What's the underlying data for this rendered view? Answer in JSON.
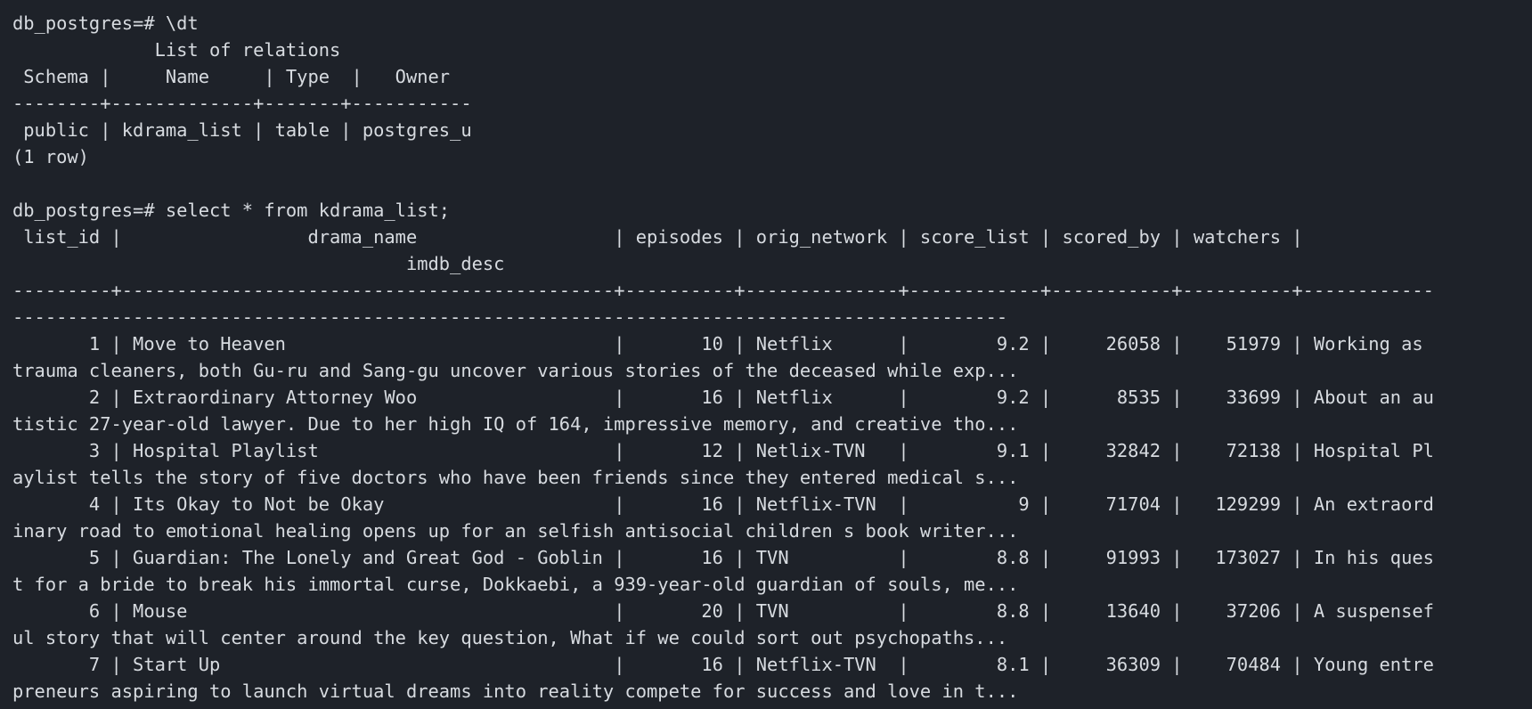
{
  "terminal": {
    "lines": [
      "db_postgres=# \\dt",
      "             List of relations",
      " Schema |     Name     | Type  |   Owner",
      "--------+-------------+-------+-----------",
      " public | kdrama_list | table | postgres_u",
      "(1 row)",
      "",
      "db_postgres=# select * from kdrama_list;",
      " list_id |                 drama_name                  | episodes | orig_network | score_list | scored_by | watchers |",
      "                                    imdb_desc",
      "---------+---------------------------------------------+----------+--------------+------------+-----------+----------+------------",
      "-------------------------------------------------------------------------------------------",
      "       1 | Move to Heaven                              |       10 | Netflix      |        9.2 |     26058 |    51979 | Working as",
      "trauma cleaners, both Gu-ru and Sang-gu uncover various stories of the deceased while exp...",
      "       2 | Extraordinary Attorney Woo                  |       16 | Netflix      |        9.2 |      8535 |    33699 | About an au",
      "tistic 27-year-old lawyer. Due to her high IQ of 164, impressive memory, and creative tho...",
      "       3 | Hospital Playlist                           |       12 | Netlix-TVN   |        9.1 |     32842 |    72138 | Hospital Pl",
      "aylist tells the story of five doctors who have been friends since they entered medical s...",
      "       4 | Its Okay to Not be Okay                     |       16 | Netflix-TVN  |          9 |     71704 |   129299 | An extraord",
      "inary road to emotional healing opens up for an selfish antisocial children s book writer...",
      "       5 | Guardian: The Lonely and Great God - Goblin |       16 | TVN          |        8.8 |     91993 |   173027 | In his ques",
      "t for a bride to break his immortal curse, Dokkaebi, a 939-year-old guardian of souls, me...",
      "       6 | Mouse                                       |       20 | TVN          |        8.8 |     13640 |    37206 | A suspensef",
      "ul story that will center around the key question, What if we could sort out psychopaths...",
      "       7 | Start Up                                    |       16 | Netflix-TVN  |        8.1 |     36309 |    70484 | Young entre",
      "preneurs aspiring to launch virtual dreams into reality compete for success and love in t...",
      "         |                                             |          |              |            |           |          |"
    ]
  }
}
